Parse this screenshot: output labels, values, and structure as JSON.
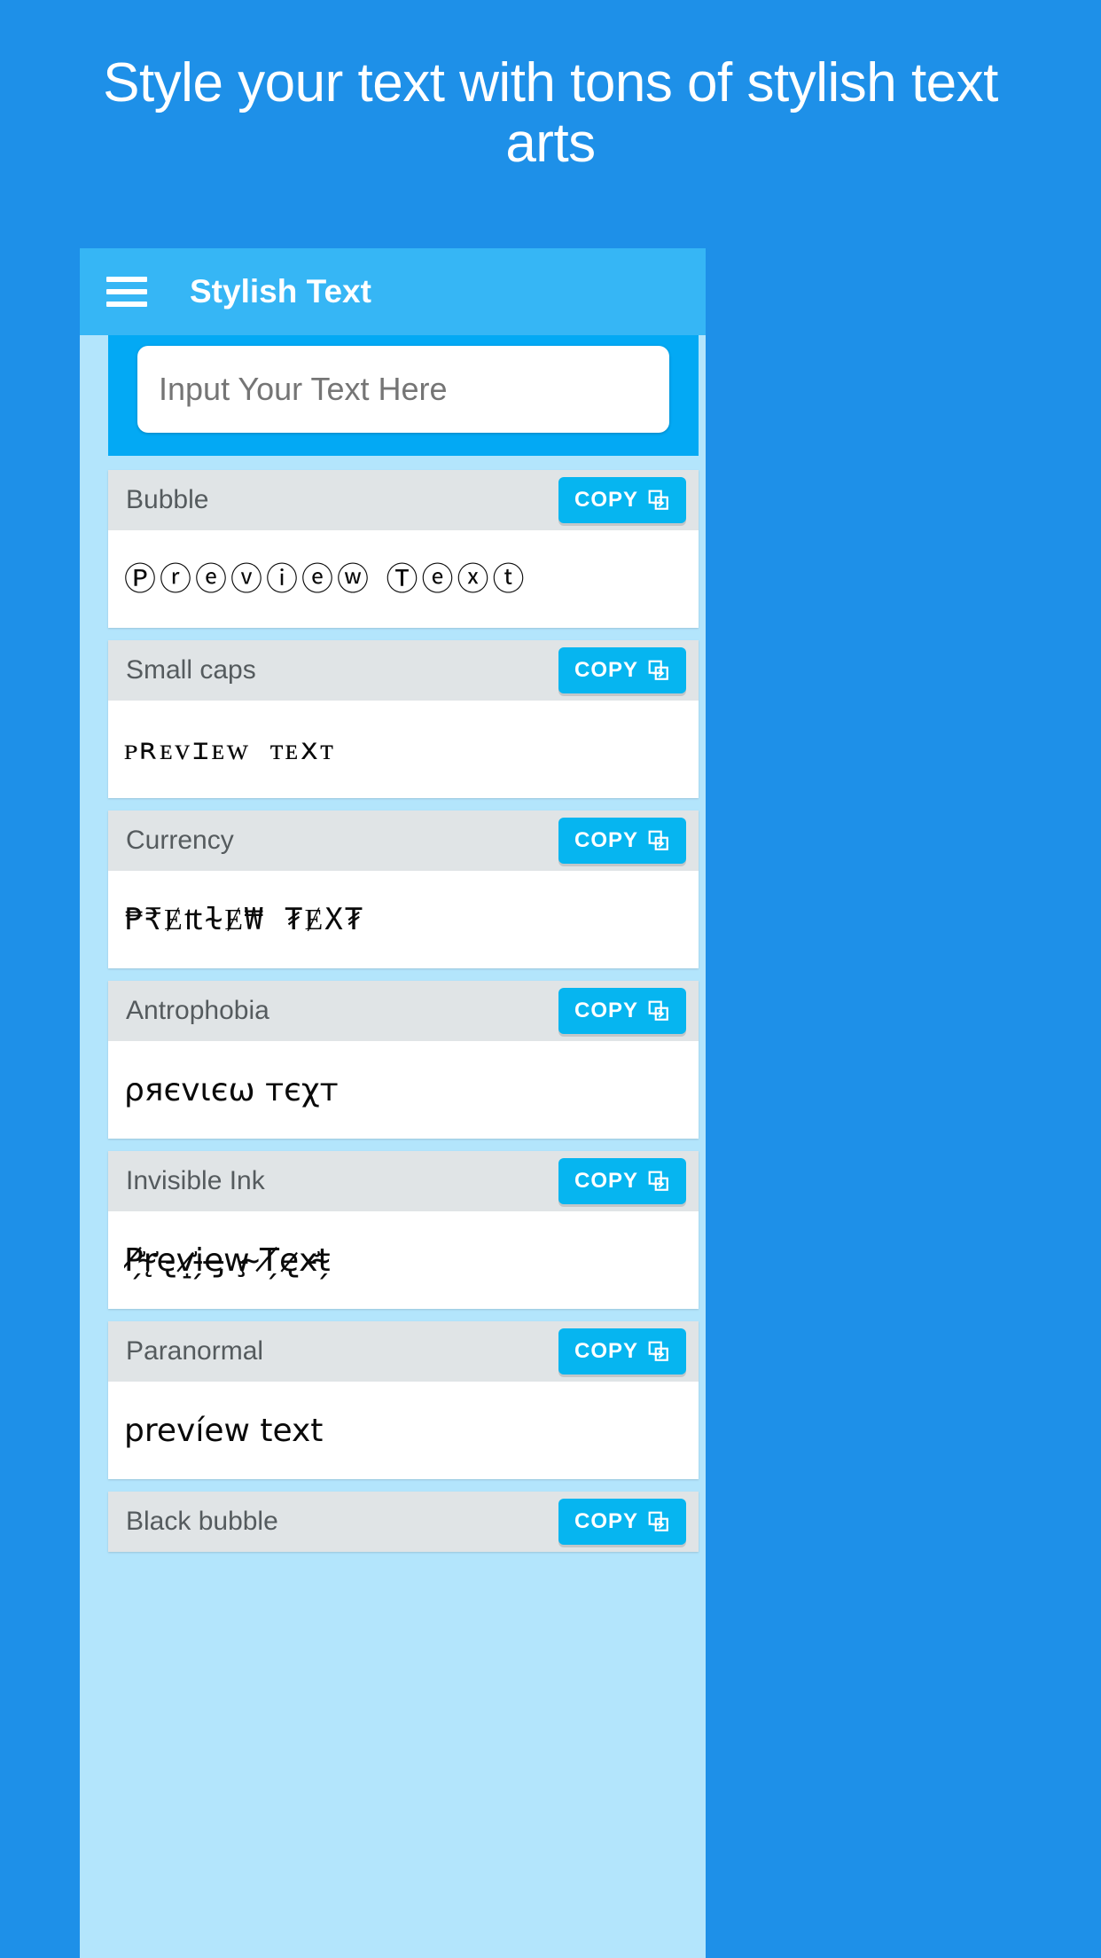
{
  "promo": {
    "headline": "Style your text with tons of stylish text arts"
  },
  "colors": {
    "page_background": "#1E90E8",
    "app_bar": "#36B6F5",
    "input_band": "#03A9F4",
    "app_body": "#B3E5FC",
    "card_header": "#E0E4E6",
    "card_body": "#FFFFFF",
    "copy_button": "#06B5F0",
    "style_name_text": "#555B5E"
  },
  "appbar": {
    "menu_icon": "hamburger-menu-icon",
    "title": "Stylish Text"
  },
  "input": {
    "value": "",
    "placeholder": "Input Your Text Here"
  },
  "copy_label": "COPY",
  "copy_icon": "copy-duplicate-icon",
  "styles": [
    {
      "name": "Bubble",
      "preview": "Ⓟⓡⓔⓥⓘⓔⓦ Ⓣⓔⓧⓣ",
      "copy_label": "COPY"
    },
    {
      "name": "Small caps",
      "preview": "ᴘʀᴇᴠɪᴇᴡ ᴛᴇxᴛ",
      "copy_label": "COPY"
    },
    {
      "name": "Currency",
      "preview": "₱₹Ɇ₶ɫɆ₩ ₮ɆX₮",
      "copy_label": "COPY"
    },
    {
      "name": "Antrophobia",
      "preview": "ρяєvιєω тєχт",
      "copy_label": "COPY"
    },
    {
      "name": "Invisible Ink",
      "preview": "P̸̛̗r̴̨̛e̵̢v̷̛̝i̵̗e̶̡w̵̧ ̴T̸̗e̷̢x̵̛t̴̗",
      "copy_label": "COPY"
    },
    {
      "name": "Paranormal",
      "preview": "prevíew text",
      "copy_label": "COPY"
    },
    {
      "name": "Black bubble",
      "preview": "",
      "copy_label": "COPY"
    }
  ]
}
